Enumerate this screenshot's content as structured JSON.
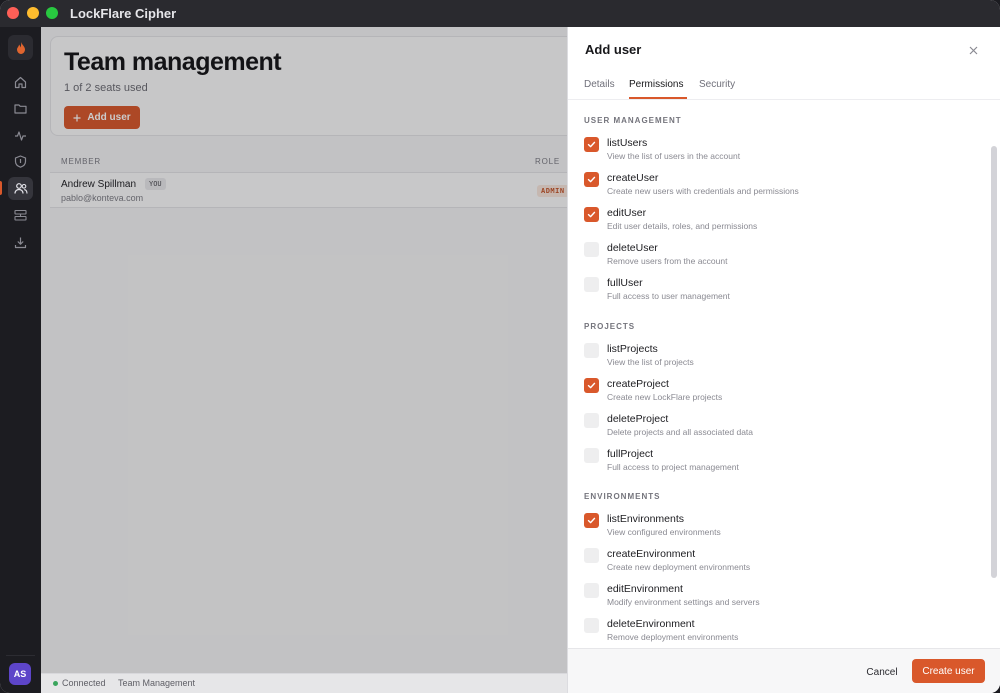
{
  "app": {
    "title": "LockFlare Cipher"
  },
  "colors": {
    "accent": "#d9582b",
    "avatar": "#5d45c9",
    "status_ok": "#3aa55d"
  },
  "sidebar": {
    "items": [
      {
        "icon": "home-icon"
      },
      {
        "icon": "folder-icon"
      },
      {
        "icon": "activity-icon"
      },
      {
        "icon": "shield-icon"
      },
      {
        "icon": "users-icon",
        "active": true
      },
      {
        "icon": "environments-icon"
      },
      {
        "icon": "download-icon"
      }
    ],
    "avatar": "AS"
  },
  "page": {
    "title": "Team management",
    "seats": "1 of 2 seats used",
    "add_user_label": "Add user"
  },
  "table": {
    "columns": {
      "member": "MEMBER",
      "role": "ROLE"
    },
    "rows": [
      {
        "name": "Andrew Spillman",
        "badge": "YOU",
        "email": "pablo@konteva.com",
        "role": "ADMIN"
      }
    ]
  },
  "status": {
    "connection": "Connected",
    "page": "Team Management"
  },
  "drawer": {
    "title": "Add user",
    "tabs": [
      "Details",
      "Permissions",
      "Security"
    ],
    "active_tab": "Permissions",
    "sections": [
      {
        "title": "USER MANAGEMENT",
        "items": [
          {
            "name": "listUsers",
            "desc": "View the list of users in the account",
            "checked": true
          },
          {
            "name": "createUser",
            "desc": "Create new users with credentials and permissions",
            "checked": true
          },
          {
            "name": "editUser",
            "desc": "Edit user details, roles, and permissions",
            "checked": true
          },
          {
            "name": "deleteUser",
            "desc": "Remove users from the account",
            "checked": false
          },
          {
            "name": "fullUser",
            "desc": "Full access to user management",
            "checked": false
          }
        ]
      },
      {
        "title": "PROJECTS",
        "items": [
          {
            "name": "listProjects",
            "desc": "View the list of projects",
            "checked": false
          },
          {
            "name": "createProject",
            "desc": "Create new LockFlare projects",
            "checked": true
          },
          {
            "name": "deleteProject",
            "desc": "Delete projects and all associated data",
            "checked": false
          },
          {
            "name": "fullProject",
            "desc": "Full access to project management",
            "checked": false
          }
        ]
      },
      {
        "title": "ENVIRONMENTS",
        "items": [
          {
            "name": "listEnvironments",
            "desc": "View configured environments",
            "checked": true
          },
          {
            "name": "createEnvironment",
            "desc": "Create new deployment environments",
            "checked": false
          },
          {
            "name": "editEnvironment",
            "desc": "Modify environment settings and servers",
            "checked": false
          },
          {
            "name": "deleteEnvironment",
            "desc": "Remove deployment environments",
            "checked": false
          }
        ]
      }
    ],
    "cancel_label": "Cancel",
    "create_label": "Create user"
  }
}
